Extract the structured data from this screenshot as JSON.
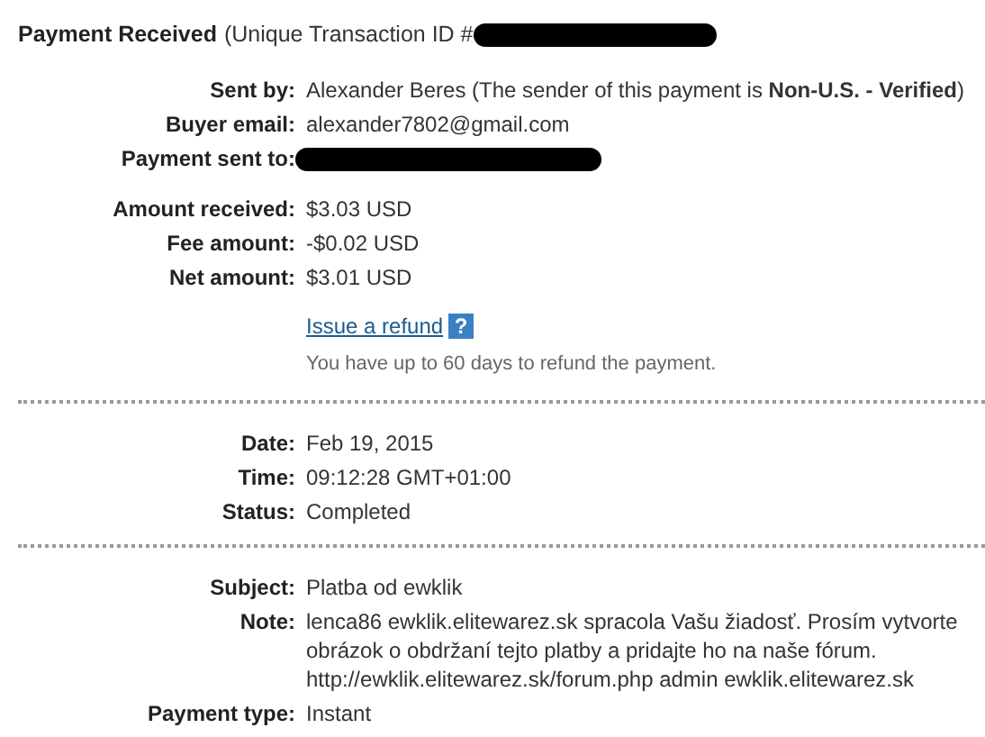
{
  "header": {
    "title": "Payment Received",
    "subtitle": "(Unique Transaction ID #",
    "id_redacted": true
  },
  "sections": [
    {
      "groups": [
        [
          {
            "label": "Sent by:",
            "value": "Alexander Beres (The sender of this payment is **Non-U.S. - Verified**)",
            "kind": "text"
          },
          {
            "label": "Buyer email:",
            "value": "alexander7802@gmail.com",
            "kind": "text"
          },
          {
            "label": "Payment sent to:",
            "kind": "redacted"
          }
        ],
        [
          {
            "label": "Amount received:",
            "value": "$3.03 USD",
            "kind": "text"
          },
          {
            "label": "Fee amount:",
            "value": "-$0.02 USD",
            "kind": "text"
          },
          {
            "label": "Net amount:",
            "value": "$3.01 USD",
            "kind": "text"
          }
        ]
      ],
      "refund": {
        "link": "Issue a refund",
        "help": "?",
        "note": "You have up to 60 days to refund the payment."
      }
    },
    {
      "groups": [
        [
          {
            "label": "Date:",
            "value": "Feb 19, 2015",
            "kind": "text"
          },
          {
            "label": "Time:",
            "value": "09:12:28 GMT+01:00",
            "kind": "text"
          },
          {
            "label": "Status:",
            "value": "Completed",
            "kind": "text"
          }
        ]
      ]
    },
    {
      "groups": [
        [
          {
            "label": "Subject:",
            "value": "Platba od ewklik",
            "kind": "text"
          },
          {
            "label": "Note:",
            "value": "lenca86 ewklik.elitewarez.sk spracola Vašu žiadosť. Prosím vytvorte obrázok o obdržaní tejto platby a pridajte ho na naše fórum. http://ewklik.elitewarez.sk/forum.php admin ewklik.elitewarez.sk",
            "kind": "text"
          },
          {
            "label": "Payment type:",
            "value": "Instant",
            "kind": "text"
          }
        ]
      ]
    }
  ]
}
